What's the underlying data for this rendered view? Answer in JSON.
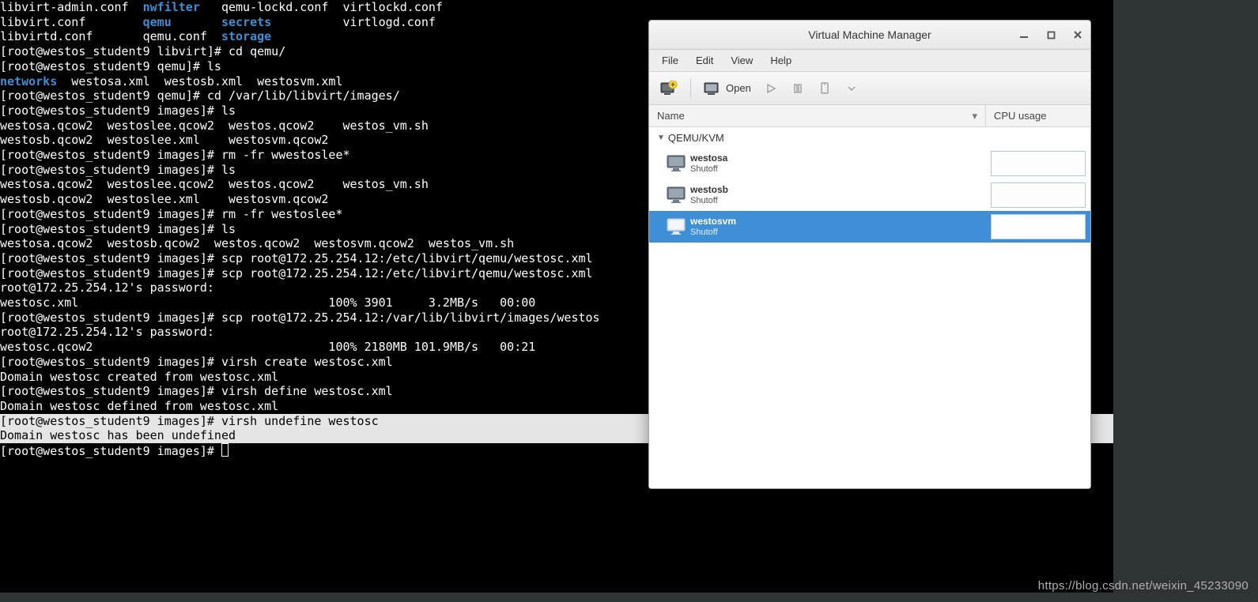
{
  "terminal": {
    "lines": [
      {
        "segs": [
          {
            "t": "libvirt-admin.conf  "
          },
          {
            "t": "nwfilter",
            "cls": "dir"
          },
          {
            "t": "   qemu-lockd.conf  virtlockd.conf"
          }
        ]
      },
      {
        "segs": [
          {
            "t": "libvirt.conf        "
          },
          {
            "t": "qemu",
            "cls": "dir"
          },
          {
            "t": "       "
          },
          {
            "t": "secrets",
            "cls": "dir"
          },
          {
            "t": "          virtlogd.conf"
          }
        ]
      },
      {
        "segs": [
          {
            "t": "libvirtd.conf       qemu.conf  "
          },
          {
            "t": "storage",
            "cls": "dir"
          }
        ]
      },
      {
        "segs": [
          {
            "t": "[root@westos_student9 libvirt]# cd qemu/"
          }
        ]
      },
      {
        "segs": [
          {
            "t": "[root@westos_student9 qemu]# ls"
          }
        ]
      },
      {
        "segs": [
          {
            "t": "networks",
            "cls": "dir"
          },
          {
            "t": "  westosa.xml  westosb.xml  westosvm.xml"
          }
        ]
      },
      {
        "segs": [
          {
            "t": "[root@westos_student9 qemu]# cd /var/lib/libvirt/images/"
          }
        ]
      },
      {
        "segs": [
          {
            "t": "[root@westos_student9 images]# ls"
          }
        ]
      },
      {
        "segs": [
          {
            "t": "westosa.qcow2  westoslee.qcow2  westos.qcow2    westos_vm.sh"
          }
        ]
      },
      {
        "segs": [
          {
            "t": "westosb.qcow2  westoslee.xml    westosvm.qcow2"
          }
        ]
      },
      {
        "segs": [
          {
            "t": "[root@westos_student9 images]# rm -fr wwestoslee*"
          }
        ]
      },
      {
        "segs": [
          {
            "t": "[root@westos_student9 images]# ls"
          }
        ]
      },
      {
        "segs": [
          {
            "t": "westosa.qcow2  westoslee.qcow2  westos.qcow2    westos_vm.sh"
          }
        ]
      },
      {
        "segs": [
          {
            "t": "westosb.qcow2  westoslee.xml    westosvm.qcow2"
          }
        ]
      },
      {
        "segs": [
          {
            "t": "[root@westos_student9 images]# rm -fr westoslee*"
          }
        ]
      },
      {
        "segs": [
          {
            "t": "[root@westos_student9 images]# ls"
          }
        ]
      },
      {
        "segs": [
          {
            "t": "westosa.qcow2  westosb.qcow2  westos.qcow2  westosvm.qcow2  westos_vm.sh"
          }
        ]
      },
      {
        "segs": [
          {
            "t": "[root@westos_student9 images]# scp root@172.25.254.12:/etc/libvirt/qemu/westosc.xml"
          }
        ]
      },
      {
        "segs": [
          {
            "t": "[root@westos_student9 images]# scp root@172.25.254.12:/etc/libvirt/qemu/westosc.xml"
          }
        ]
      },
      {
        "segs": [
          {
            "t": "root@172.25.254.12's password: "
          }
        ]
      },
      {
        "segs": [
          {
            "t": "westosc.xml                                   100% 3901     3.2MB/s   00:00    "
          }
        ]
      },
      {
        "segs": [
          {
            "t": "[root@westos_student9 images]# scp root@172.25.254.12:/var/lib/libvirt/images/westos"
          }
        ]
      },
      {
        "segs": [
          {
            "t": "root@172.25.254.12's password: "
          }
        ]
      },
      {
        "segs": [
          {
            "t": "westosc.qcow2                                 100% 2180MB 101.9MB/s   00:21    "
          }
        ]
      },
      {
        "segs": [
          {
            "t": "[root@westos_student9 images]# virsh create westosc.xml"
          }
        ]
      },
      {
        "segs": [
          {
            "t": "Domain westosc created from westosc.xml"
          }
        ]
      },
      {
        "segs": [
          {
            "t": ""
          }
        ]
      },
      {
        "segs": [
          {
            "t": "[root@westos_student9 images]# virsh define westosc.xml"
          }
        ]
      },
      {
        "segs": [
          {
            "t": "Domain westosc defined from westosc.xml"
          }
        ]
      },
      {
        "segs": [
          {
            "t": ""
          }
        ]
      },
      {
        "segs": [
          {
            "t": "[root@westos_student9 images]# ",
            "cls": "highlighted"
          },
          {
            "t": "virsh undefine westosc",
            "cls": "highlighted",
            "pad": true
          }
        ]
      },
      {
        "segs": [
          {
            "t": "Domain westosc has been undefined",
            "cls": "highlighted",
            "pad": true
          }
        ]
      },
      {
        "segs": [
          {
            "t": ""
          }
        ]
      },
      {
        "segs": [
          {
            "t": "[root@westos_student9 images]# "
          },
          {
            "cursor": true
          }
        ]
      }
    ]
  },
  "window": {
    "title": "Virtual Machine Manager",
    "menu": [
      "File",
      "Edit",
      "View",
      "Help"
    ],
    "toolbar": {
      "open": "Open"
    },
    "columns": {
      "name": "Name",
      "cpu": "CPU usage"
    },
    "group": "QEMU/KVM",
    "vms": [
      {
        "name": "westosa",
        "status": "Shutoff",
        "selected": false
      },
      {
        "name": "westosb",
        "status": "Shutoff",
        "selected": false
      },
      {
        "name": "westosvm",
        "status": "Shutoff",
        "selected": true
      }
    ]
  },
  "watermark": "https://blog.csdn.net/weixin_45233090"
}
